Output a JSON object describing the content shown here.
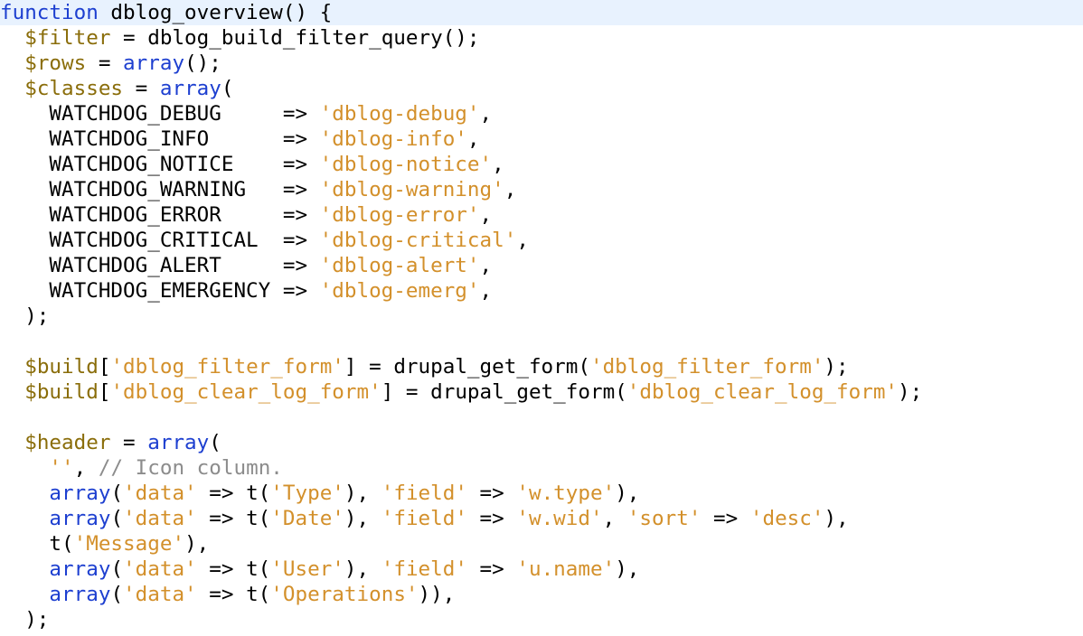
{
  "editor": {
    "language": "php",
    "current_line": 0,
    "colors": {
      "keyword": "#1d3fd0",
      "variable": "#8a6d0a",
      "string": "#d3902b",
      "comment": "#8c8c8c",
      "plain": "#000000",
      "current_line_bg": "#e8f2fe"
    },
    "lines": [
      [
        [
          "kw",
          "function"
        ],
        [
          "plain",
          " dblog_overview() {"
        ]
      ],
      [
        [
          "plain",
          "  "
        ],
        [
          "var",
          "$filter"
        ],
        [
          "plain",
          " = dblog_build_filter_query();"
        ]
      ],
      [
        [
          "plain",
          "  "
        ],
        [
          "var",
          "$rows"
        ],
        [
          "plain",
          " = "
        ],
        [
          "kw",
          "array"
        ],
        [
          "plain",
          "();"
        ]
      ],
      [
        [
          "plain",
          "  "
        ],
        [
          "var",
          "$classes"
        ],
        [
          "plain",
          " = "
        ],
        [
          "kw",
          "array"
        ],
        [
          "plain",
          "("
        ]
      ],
      [
        [
          "plain",
          "    WATCHDOG_DEBUG     => "
        ],
        [
          "str",
          "'dblog-debug'"
        ],
        [
          "plain",
          ","
        ]
      ],
      [
        [
          "plain",
          "    WATCHDOG_INFO      => "
        ],
        [
          "str",
          "'dblog-info'"
        ],
        [
          "plain",
          ","
        ]
      ],
      [
        [
          "plain",
          "    WATCHDOG_NOTICE    => "
        ],
        [
          "str",
          "'dblog-notice'"
        ],
        [
          "plain",
          ","
        ]
      ],
      [
        [
          "plain",
          "    WATCHDOG_WARNING   => "
        ],
        [
          "str",
          "'dblog-warning'"
        ],
        [
          "plain",
          ","
        ]
      ],
      [
        [
          "plain",
          "    WATCHDOG_ERROR     => "
        ],
        [
          "str",
          "'dblog-error'"
        ],
        [
          "plain",
          ","
        ]
      ],
      [
        [
          "plain",
          "    WATCHDOG_CRITICAL  => "
        ],
        [
          "str",
          "'dblog-critical'"
        ],
        [
          "plain",
          ","
        ]
      ],
      [
        [
          "plain",
          "    WATCHDOG_ALERT     => "
        ],
        [
          "str",
          "'dblog-alert'"
        ],
        [
          "plain",
          ","
        ]
      ],
      [
        [
          "plain",
          "    WATCHDOG_EMERGENCY => "
        ],
        [
          "str",
          "'dblog-emerg'"
        ],
        [
          "plain",
          ","
        ]
      ],
      [
        [
          "plain",
          "  );"
        ]
      ],
      [
        [
          "plain",
          ""
        ]
      ],
      [
        [
          "plain",
          "  "
        ],
        [
          "var",
          "$build"
        ],
        [
          "plain",
          "["
        ],
        [
          "str",
          "'dblog_filter_form'"
        ],
        [
          "plain",
          "] = drupal_get_form("
        ],
        [
          "str",
          "'dblog_filter_form'"
        ],
        [
          "plain",
          ");"
        ]
      ],
      [
        [
          "plain",
          "  "
        ],
        [
          "var",
          "$build"
        ],
        [
          "plain",
          "["
        ],
        [
          "str",
          "'dblog_clear_log_form'"
        ],
        [
          "plain",
          "] = drupal_get_form("
        ],
        [
          "str",
          "'dblog_clear_log_form'"
        ],
        [
          "plain",
          ");"
        ]
      ],
      [
        [
          "plain",
          ""
        ]
      ],
      [
        [
          "plain",
          "  "
        ],
        [
          "var",
          "$header"
        ],
        [
          "plain",
          " = "
        ],
        [
          "kw",
          "array"
        ],
        [
          "plain",
          "("
        ]
      ],
      [
        [
          "plain",
          "    "
        ],
        [
          "str",
          "''"
        ],
        [
          "plain",
          ", "
        ],
        [
          "com",
          "// Icon column."
        ]
      ],
      [
        [
          "plain",
          "    "
        ],
        [
          "kw",
          "array"
        ],
        [
          "plain",
          "("
        ],
        [
          "str",
          "'data'"
        ],
        [
          "plain",
          " => t("
        ],
        [
          "str",
          "'Type'"
        ],
        [
          "plain",
          "), "
        ],
        [
          "str",
          "'field'"
        ],
        [
          "plain",
          " => "
        ],
        [
          "str",
          "'w.type'"
        ],
        [
          "plain",
          "),"
        ]
      ],
      [
        [
          "plain",
          "    "
        ],
        [
          "kw",
          "array"
        ],
        [
          "plain",
          "("
        ],
        [
          "str",
          "'data'"
        ],
        [
          "plain",
          " => t("
        ],
        [
          "str",
          "'Date'"
        ],
        [
          "plain",
          "), "
        ],
        [
          "str",
          "'field'"
        ],
        [
          "plain",
          " => "
        ],
        [
          "str",
          "'w.wid'"
        ],
        [
          "plain",
          ", "
        ],
        [
          "str",
          "'sort'"
        ],
        [
          "plain",
          " => "
        ],
        [
          "str",
          "'desc'"
        ],
        [
          "plain",
          "),"
        ]
      ],
      [
        [
          "plain",
          "    t("
        ],
        [
          "str",
          "'Message'"
        ],
        [
          "plain",
          "),"
        ]
      ],
      [
        [
          "plain",
          "    "
        ],
        [
          "kw",
          "array"
        ],
        [
          "plain",
          "("
        ],
        [
          "str",
          "'data'"
        ],
        [
          "plain",
          " => t("
        ],
        [
          "str",
          "'User'"
        ],
        [
          "plain",
          "), "
        ],
        [
          "str",
          "'field'"
        ],
        [
          "plain",
          " => "
        ],
        [
          "str",
          "'u.name'"
        ],
        [
          "plain",
          "),"
        ]
      ],
      [
        [
          "plain",
          "    "
        ],
        [
          "kw",
          "array"
        ],
        [
          "plain",
          "("
        ],
        [
          "str",
          "'data'"
        ],
        [
          "plain",
          " => t("
        ],
        [
          "str",
          "'Operations'"
        ],
        [
          "plain",
          ")),"
        ]
      ],
      [
        [
          "plain",
          "  );"
        ]
      ]
    ]
  }
}
